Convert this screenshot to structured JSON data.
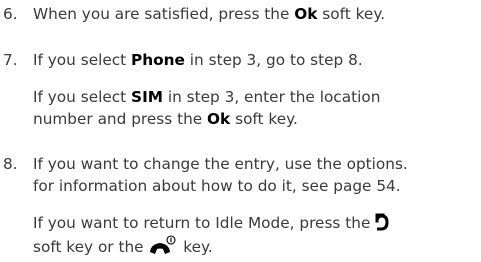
{
  "step6": {
    "number": "6.",
    "text_before": "When you are satisfied, press the ",
    "key": "Ok",
    "text_after": " soft key."
  },
  "step7": {
    "number": "7.",
    "line_a": {
      "text_before": "If you select ",
      "key": "Phone",
      "text_after": " in step 3, go to step 8."
    },
    "line_b1": {
      "text_before": "If you select ",
      "key": "SIM",
      "text_after": " in step 3, enter the location"
    },
    "line_b2": {
      "text_before": "number and press the ",
      "key": "Ok",
      "text_after": " soft key."
    }
  },
  "step8": {
    "number": "8.",
    "line_a1": "If you want to change the entry, use the options.",
    "line_a2": "for information about how to do it, see page 54.",
    "line_b1": "If you want to return to Idle Mode, press the ",
    "line_b2_before": "soft key or the ",
    "line_b2_after": " key.",
    "icons": {
      "back": "back-arrow-icon",
      "end": "end-power-key-icon"
    }
  }
}
